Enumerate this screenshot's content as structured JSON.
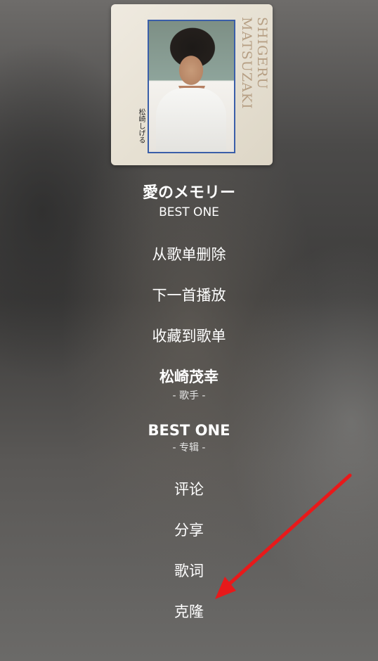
{
  "song": {
    "title": "愛のメモリー",
    "album": "BEST ONE"
  },
  "cover": {
    "artist_romaji": "SHIGERU MATSUZAKI",
    "artist_kana": "松崎しげる"
  },
  "menu": {
    "remove": "从歌单删除",
    "play_next": "下一首播放",
    "collect": "收藏到歌单",
    "artist_name": "松崎茂幸",
    "artist_sub": "- 歌手 -",
    "album_name": "BEST ONE",
    "album_sub": "- 专辑 -",
    "comments": "评论",
    "share": "分享",
    "lyrics": "歌词",
    "clone": "克隆"
  },
  "colors": {
    "annotation_arrow": "#e8191a"
  }
}
